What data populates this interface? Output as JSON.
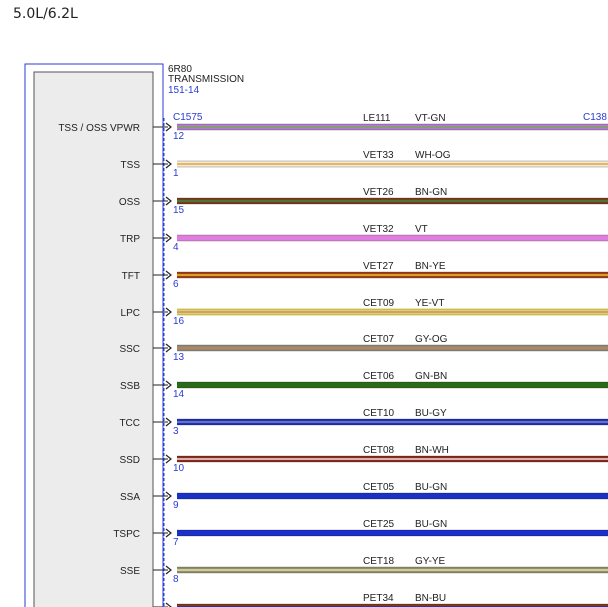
{
  "header": {
    "engine": "5.0L/6.2L"
  },
  "component": {
    "name_line1": "6R80",
    "name_line2": "TRANSMISSION",
    "ref": "151-14",
    "connector": "C1575",
    "far_connector": "C138"
  },
  "colors": {
    "box_outline": "#2a3bd6",
    "module_fill": "#ececec",
    "pin_number": "#2a3bd6",
    "text": "#222222"
  },
  "pins": [
    {
      "label": "TSS / OSS VPWR",
      "pin": "12",
      "circuit": "LE111",
      "wire_color": "VT-GN",
      "c1": "#b07bd0",
      "c2": "#7aa84f"
    },
    {
      "label": "TSS",
      "pin": "1",
      "circuit": "VET33",
      "wire_color": "WH-OG",
      "c1": "#f2ecd6",
      "c2": "#e8a040"
    },
    {
      "label": "OSS",
      "pin": "15",
      "circuit": "VET26",
      "wire_color": "BN-GN",
      "c1": "#7a3b1e",
      "c2": "#3c8a3a"
    },
    {
      "label": "TRP",
      "pin": "4",
      "circuit": "VET32",
      "wire_color": "VT",
      "c1": "#e07ee0",
      "c2": "#e07ee0"
    },
    {
      "label": "TFT",
      "pin": "6",
      "circuit": "VET27",
      "wire_color": "BN-YE",
      "c1": "#a0401c",
      "c2": "#f0c020"
    },
    {
      "label": "LPC",
      "pin": "16",
      "circuit": "CET09",
      "wire_color": "YE-VT",
      "c1": "#e8d830",
      "c2": "#c080d0"
    },
    {
      "label": "SSC",
      "pin": "13",
      "circuit": "CET07",
      "wire_color": "GY-OG",
      "c1": "#8a8a80",
      "c2": "#d08040"
    },
    {
      "label": "SSB",
      "pin": "14",
      "circuit": "CET06",
      "wire_color": "GN-BN",
      "c1": "#2a6a18",
      "c2": "#2a6a18"
    },
    {
      "label": "TCC",
      "pin": "3",
      "circuit": "CET10",
      "wire_color": "BU-GY",
      "c1": "#1a30c8",
      "c2": "#8a8a9a"
    },
    {
      "label": "SSD",
      "pin": "10",
      "circuit": "CET08",
      "wire_color": "BN-WH",
      "c1": "#8a2a1c",
      "c2": "#f0e0e0"
    },
    {
      "label": "SSA",
      "pin": "9",
      "circuit": "CET05",
      "wire_color": "BU-GN",
      "c1": "#1a30c8",
      "c2": "#1a30c8"
    },
    {
      "label": "TSPC",
      "pin": "7",
      "circuit": "CET25",
      "wire_color": "BU-GN",
      "c1": "#1a30c8",
      "c2": "#1a30c8"
    },
    {
      "label": "SSE",
      "pin": "8",
      "circuit": "CET18",
      "wire_color": "GY-YE",
      "c1": "#909070",
      "c2": "#e8e0a0"
    },
    {
      "label": "",
      "pin": "",
      "circuit": "PET34",
      "wire_color": "BN-BU",
      "c1": "#7a3b1e",
      "c2": "#1a30c8"
    }
  ]
}
